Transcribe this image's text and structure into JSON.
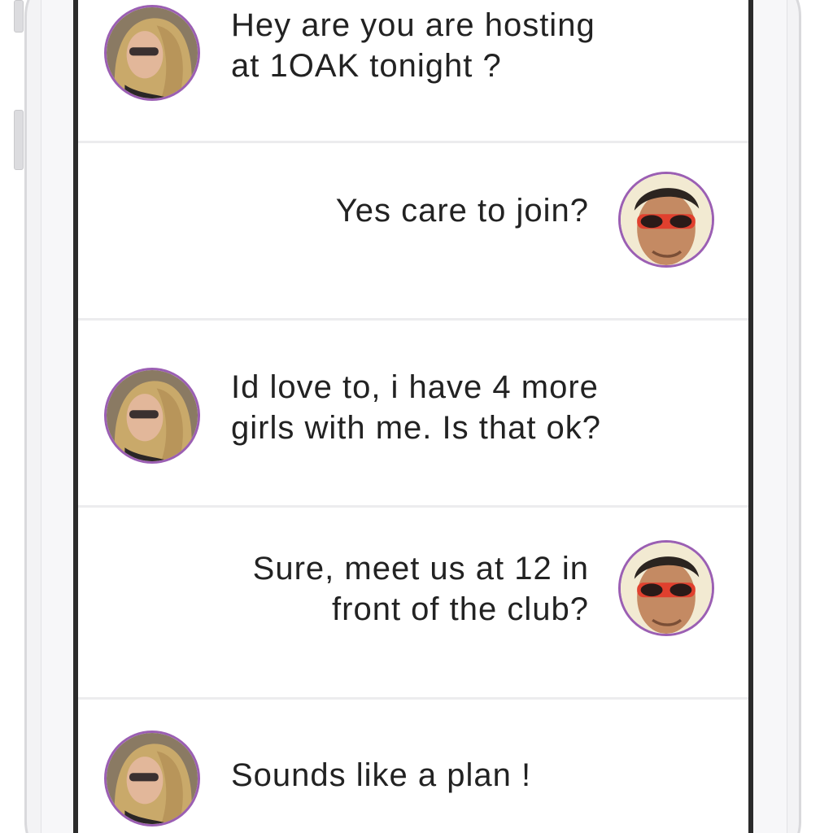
{
  "conversation": {
    "messages": [
      {
        "sender": "her",
        "side": "left",
        "avatar_icon": "female-avatar",
        "text": "Hey are you are hosting\nat 1OAK tonight ?"
      },
      {
        "sender": "him",
        "side": "right",
        "avatar_icon": "male-avatar-sunglasses",
        "text": "Yes care to join?"
      },
      {
        "sender": "her",
        "side": "left",
        "avatar_icon": "female-avatar",
        "text": "Id love to, i have 4 more\ngirls with me. Is that ok?"
      },
      {
        "sender": "him",
        "side": "right",
        "avatar_icon": "male-avatar-sunglasses",
        "text": "Sure, meet us at 12 in\nfront of the club?"
      },
      {
        "sender": "her",
        "side": "left",
        "avatar_icon": "female-avatar",
        "text": "Sounds like a plan !"
      }
    ]
  },
  "colors": {
    "avatar_ring": "#9b5fb3",
    "text": "#222222",
    "divider": "#ececee",
    "screen_bezel": "#2b2b2b"
  }
}
